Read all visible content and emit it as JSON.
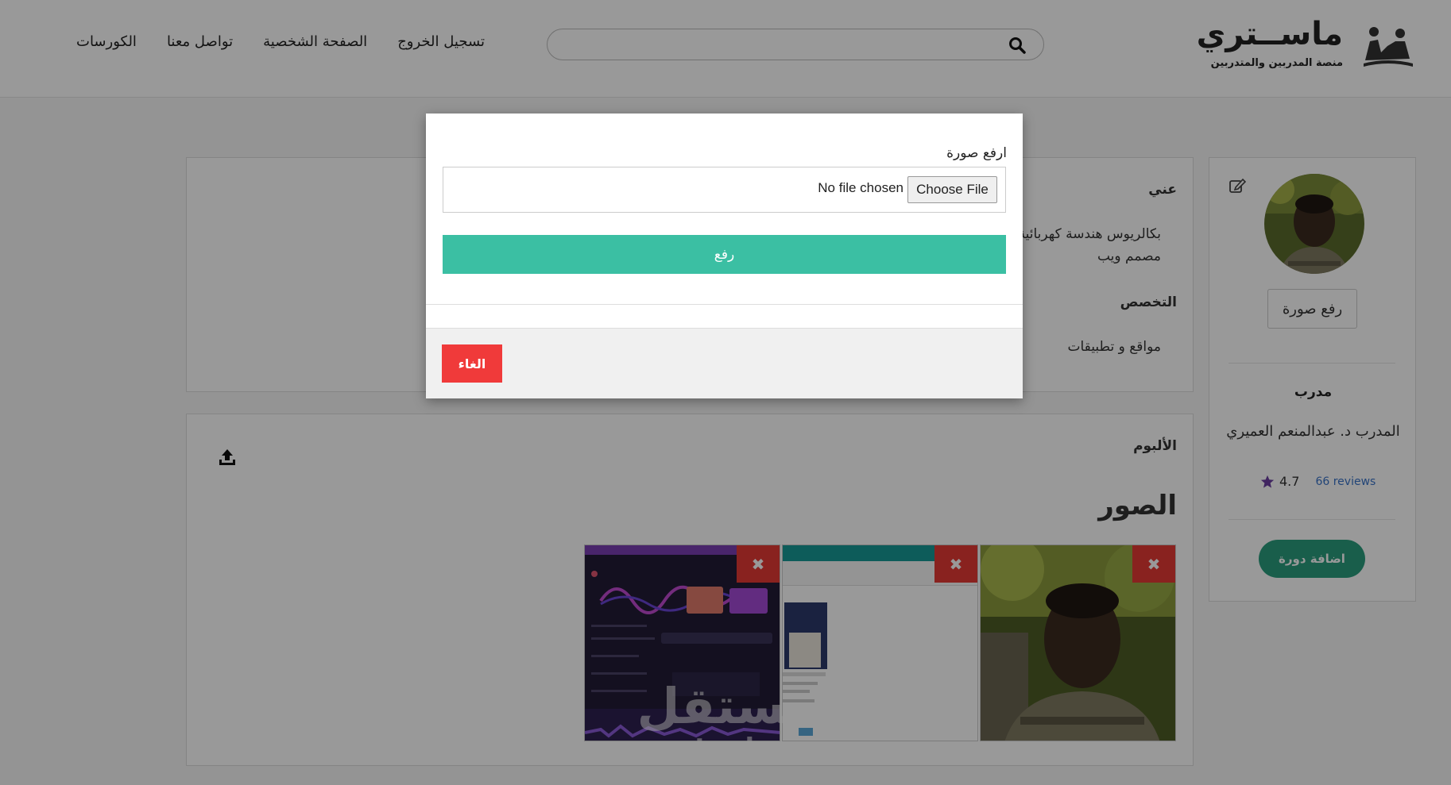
{
  "header": {
    "logo_title": "ماســتري",
    "logo_subtitle": "منصة المدربين والمتدربين",
    "search_placeholder": "",
    "nav": [
      "الكورسات",
      "تواصل معنا",
      "الصفحة الشخصية",
      "تسجيل الخروج"
    ]
  },
  "profile": {
    "upload_photo_label": "رفع صورة",
    "role": "مدرب",
    "name": "المدرب د. عبدالمنعم العميري",
    "rating": "4.7",
    "reviews": "66 reviews",
    "add_course_label": "اضافة دورة"
  },
  "about": {
    "title": "عني",
    "line1": "بكالريوس هندسة كهربائية",
    "line2": "مصمم ويب",
    "spec_title": "التخصص",
    "spec_value": "مواقع و تطبيقات"
  },
  "album": {
    "title": "الألبوم",
    "photos_heading": "الصور",
    "remove_glyph": "✖"
  },
  "modal": {
    "label": "ارفع صورة",
    "file_button": "Choose File",
    "file_status": "No file chosen",
    "upload_label": "رفع",
    "cancel_label": "الغاء"
  },
  "watermark": {
    "ar": "مستقل",
    "en": "mostaql.com"
  },
  "colors": {
    "primary_green": "#3bbfa3",
    "dark_green": "#2a9d7e",
    "danger_red": "#f03a3a",
    "link_blue": "#3a73c8",
    "star_purple": "#6b3fa0"
  }
}
